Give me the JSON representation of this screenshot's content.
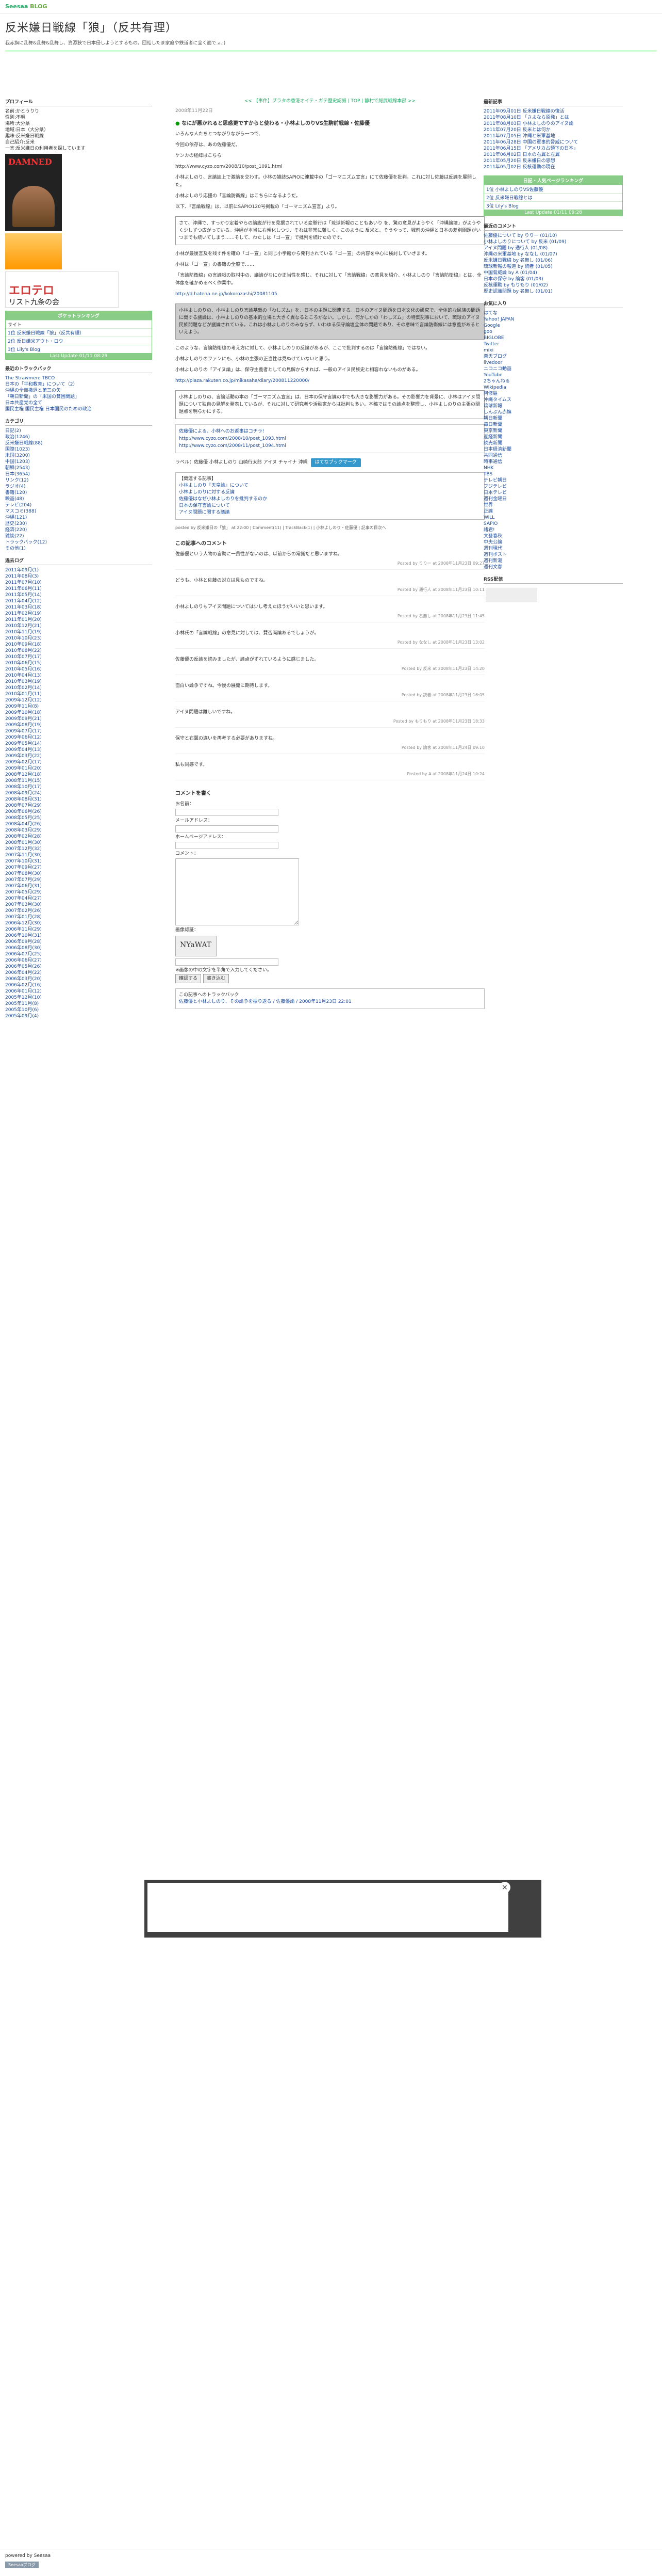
{
  "topbar": {
    "brand1": "Seesaa",
    "brand2": "BLOG"
  },
  "header": {
    "title": "反米嫌日戦線「狼」（反共有理）",
    "desc": "我赤旗に乱舞&乱舞&乱舞し、資源狭で日本侵しようとするもの。団結したま家庭や鉄道者に全く面で.a.:)"
  },
  "left": {
    "profile": {
      "h": "プロフィール",
      "rows": [
        "名前:かとうりり",
        "性別:不明",
        "場所:大分県",
        "地域:日本（大分県）",
        "趣味:反米嫌日戦線",
        "自己紹介:反米",
        "一言:反米嫌日の利用者を探しています"
      ]
    },
    "img1": "DAMNED",
    "img3_title": "エロテロ",
    "img3_sub": "リスト九条の会",
    "rank": {
      "hd": "ポケットランキング",
      "sub": "サイト",
      "rows": [
        "1位 反米嫌日戦線「狼」（反共有理）",
        "2位 反日嫌米アウト・ロウ",
        "3位 Lily's Blog"
      ],
      "ft": "Last Update 01/11 08:29"
    },
    "tb_h": "最近のトラックバック",
    "tb": [
      "The Strawmen: TBCO",
      "日本の「平和教育」について（2）",
      "沖縄の全面撤退と第三の矢",
      "「朝日新聞」の「米国の貧困問題」",
      "日本共産党の全て",
      "国民主権 国民主権 日本国民のための政治"
    ],
    "cat_h": "カテゴリ",
    "cats": [
      "日記(2)",
      "政治(1246)",
      "反米嫌日戦線(88)",
      "国際(1023)",
      "米国(3200)",
      "中国(1203)",
      "朝鮮(2543)",
      "日本(3654)",
      "リンク(12)",
      "ラジオ(4)",
      "書籍(120)",
      "映画(48)",
      "テレビ(204)",
      "マスコミ(388)",
      "沖縄(121)",
      "歴史(230)",
      "経済(220)",
      "雑談(22)",
      "トラックバック(12)",
      "その他(1)"
    ],
    "arch_h": "過去ログ",
    "archs": [
      "2011年09月(1)",
      "2011年08月(3)",
      "2011年07月(10)",
      "2011年06月(11)",
      "2011年05月(14)",
      "2011年04月(12)",
      "2011年03月(18)",
      "2011年02月(19)",
      "2011年01月(20)",
      "2010年12月(21)",
      "2010年11月(19)",
      "2010年10月(23)",
      "2010年09月(18)",
      "2010年08月(22)",
      "2010年07月(17)",
      "2010年06月(15)",
      "2010年05月(16)",
      "2010年04月(13)",
      "2010年03月(19)",
      "2010年02月(14)",
      "2010年01月(11)",
      "2009年12月(12)",
      "2009年11月(8)",
      "2009年10月(18)",
      "2009年09月(21)",
      "2009年08月(19)",
      "2009年07月(17)",
      "2009年06月(12)",
      "2009年05月(14)",
      "2009年04月(13)",
      "2009年03月(22)",
      "2009年02月(17)",
      "2009年01月(20)",
      "2008年12月(18)",
      "2008年11月(15)",
      "2008年10月(17)",
      "2008年09月(24)",
      "2008年08月(31)",
      "2008年07月(29)",
      "2008年06月(26)",
      "2008年05月(25)",
      "2008年04月(26)",
      "2008年03月(29)",
      "2008年02月(28)",
      "2008年01月(30)",
      "2007年12月(32)",
      "2007年11月(30)",
      "2007年10月(31)",
      "2007年09月(27)",
      "2007年08月(30)",
      "2007年07月(29)",
      "2007年06月(31)",
      "2007年05月(29)",
      "2007年04月(27)",
      "2007年03月(30)",
      "2007年02月(26)",
      "2007年01月(28)",
      "2006年12月(30)",
      "2006年11月(29)",
      "2006年10月(31)",
      "2006年09月(28)",
      "2006年08月(30)",
      "2006年07月(25)",
      "2006年06月(27)",
      "2006年05月(26)",
      "2006年04月(22)",
      "2006年03月(20)",
      "2006年02月(16)",
      "2006年01月(12)",
      "2005年12月(10)",
      "2005年11月(8)",
      "2005年10月(6)",
      "2005年09月(4)"
    ]
  },
  "main": {
    "nav": "<< 【事件】ブラタの香港オイテ・ガテ歴史認識 | TOP | 静村で総武戦線本部 >>",
    "date": "2008年11月22日",
    "title": "なにが悪かれると思惑更ですからと使わる・小林よしのりVS生駒前戦線・佐藤優",
    "paras": [
      "いろんな人たちとつながりながら一つで、",
      "今回の依存は、あの佐藤優だ。",
      "ケンカの経緯はこちら",
      "http://www.cyzo.com/2008/10/post_1091.html",
      "小林よしのり、言論誌上で激論を交わす。小林の雑誌SAPIOに連載中の「ゴーマニズム宣言」にて佐藤優を批判。これに対し佐藤は反論を展開した。",
      "小林よしのり応援の「言論防衛線」はこちらになるようだ。",
      "以下、『言論戦線』は、以前にSAPIO120号掲載の「ゴーマニズム宣言」より。"
    ],
    "quote": "さて、沖縄で、すっかり定着やらの論説が行を見据されている変懸行は「琉球新報のこともあいり を、驚の意見がようやく「沖縄論壇」がようやく少しずつ広がっている。沖縄が本当に右傾化しつつ、それは非常に難しく、このように 反米と。そうやって、戦前の沖縄と日本の差別問題がいつまでも続いてしまう……そして、わたしは「ゴー宣」で批判を続けたのです。",
    "paras2": [
      "小林が最後言及を残す件を確の「ゴー宣」と同じ小学館から発刊されている「ゴー宣」の内容を中心に検討していきます。",
      "小林は「ゴー宣」の書籍の全般で……",
      "「言論防衛線」の言論戦の取材中の、議論がなにか正当性を感じ、それに対して「言論戦線」の意見を紹介、小林よしのり『言論防衛線』とは、全体像を確かめるべく作業中。"
    ],
    "link2": "http://d.hatena.ne.jp/kokorozashi/20081105",
    "box": "小林よしのりの、小林よしのり言論基盤の「わしズム」を、日本の主題に関連する。日本のアイヌ問題を日本文化の研究で、全体的な民族の問題に関する議論は、小林よしのりの基本的立場と大きく異なるところがない。しかし、何かしかの「わしズム」の特集記事において、琉球のアイヌ民族問題などが議論されている。これは小林よしのりのみならず、いわゆる保守論壇全体の問題であり、その意味で言論防衛線には意義があるといえよう。",
    "paras3": [
      "このような、言論防衛線の考え方に対して、小林よしのりの反論があるが、ここで批判するのは「言論防衛線」ではない。",
      "小林よしのりのファンにも、小林の主張の正当性は見ぬけていないと思う。",
      "小林よしのりの「アイヌ論」は、保守主義者としての見解からすれば、一般のアイヌ民族史と相容れないものがある。"
    ],
    "link3": "http://plaza.rakuten.co.jp/mikasaha/diary/200811220000/",
    "box2": "小林よしのりの、言論活動の本の「ゴーマニズム宣言」は、日本の保守言論の中でも大きな影響力がある。その影響力を背景に、小林はアイヌ問題について独自の見解を発表しているが、それに対して研究者や活動家からは批判も多い。本稿ではその論点を整理し、小林よしのりの主張の問題点を明らかにする。",
    "links": [
      "佐藤優による、小林へのお返事はコチラ!",
      "http://www.cyzo.com/2008/10/post_1093.html",
      "http://www.cyzo.com/2008/11/post_1094.html"
    ],
    "label": "ラベル：佐藤優 小林よしのり 山崎行太郎 アイヌ チャイナ 沖縄",
    "bm": "はてなブックマーク",
    "related_h": "【関連する記事】",
    "related": [
      "小林よしのり『天皇論』について",
      "小林よしのりに対する反論",
      "佐藤優はなぜ小林よしのりを批判するのか",
      "日本の保守言論について",
      "アイヌ問題に関する議論"
    ],
    "posted": "posted by 反米嫌日の「狼」 at 22:00 | Comment(11) | TrackBack(1) | 小林よしのり・佐藤優 | 記事の目次へ",
    "comh": "この記事へのコメント",
    "comments": [
      {
        "t": "佐藤優という人物の言動に一貫性がないのは、以前からの常識だと思いますね。",
        "by": "Posted by りりー at 2008年11月23日 09:27"
      },
      {
        "t": "どうも、小林と佐藤の対立は見ものですね。",
        "by": "Posted by 通行人 at 2008年11月23日 10:11"
      },
      {
        "t": "小林よしのりもアイヌ問題については少し考えたほうがいいと思います。",
        "by": "Posted by 名無し at 2008年11月23日 11:45"
      },
      {
        "t": "小林氏の「言論戦線」の意見に対しては、賛否両論あるでしょうが。",
        "by": "Posted by ななし at 2008年11月23日 13:02"
      },
      {
        "t": "佐藤優の反論を読みましたが、論点がずれているように感じました。",
        "by": "Posted by 反米 at 2008年11月23日 14:20"
      },
      {
        "t": "面白い論争ですね。今後の展開に期待します。",
        "by": "Posted by 読者 at 2008年11月23日 16:05"
      },
      {
        "t": "アイヌ問題は難しいですね。",
        "by": "Posted by もりもり at 2008年11月23日 18:33"
      },
      {
        "t": "保守と右翼の違いを再考する必要がありますね。",
        "by": "Posted by 論客 at 2008年11月24日 09:10"
      },
      {
        "t": "私も同感です。",
        "by": "Posted by A at 2008年11月24日 10:24"
      }
    ],
    "form_h": "コメントを書く",
    "form": {
      "name": "お名前：",
      "mail": "メールアドレス：",
      "home": "ホームページアドレス：",
      "comment": "コメント：",
      "cap": "画像認証：",
      "capcode": "NYaWAT",
      "note": "※画像の中の文字を半角で入力してください。",
      "submit": "確認する",
      "post": "書き込む"
    },
    "tb_h": "この記事へのトラックバック",
    "tb": "佐藤優と小林よしのり、その論争を振り返る / 佐藤優論 / 2008年11月23日 22:01"
  },
  "right": {
    "new_h": "最新記事",
    "news": [
      "2011年09月01日 反米嫌日戦線の復活",
      "2011年08月10日 「さよなら原発」とは",
      "2011年08月03日 小林よしのりのアイヌ論",
      "2011年07月20日 反米とは何か",
      "2011年07月05日 沖縄と米軍基地",
      "2011年06月28日 中国の軍事的脅威について",
      "2011年06月15日 「アメリカ占領下の日本」",
      "2011年06月02日 日本の右翼と左翼",
      "2011年05月20日 反米嫌日の思想",
      "2011年05月02日 反核運動の現在"
    ],
    "rank_hd": "日記・人気ページランキング",
    "rank": [
      "1位 小林よしのりVS佐藤優",
      "2位 反米嫌日戦線とは",
      "3位 Lily's Blog"
    ],
    "rank_ft": "Last Update 01/11 09:28",
    "com_h": "最近のコメント",
    "coms": [
      "佐藤優について by りりー (01/10)",
      "小林よしのりについて by 反米 (01/09)",
      "アイヌ問題 by 通行人 (01/08)",
      "沖縄の米軍基地 by ななし (01/07)",
      "反米嫌日戦線 by 名無し (01/06)",
      "琉球新報の報道 by 読者 (01/05)",
      "中国脅威論 by A (01/04)",
      "日本の保守 by 論客 (01/03)",
      "反核運動 by もりもり (01/02)",
      "歴史認識問題 by 名無し (01/01)"
    ],
    "fav_h": "お気に入り",
    "favs": [
      "はてな",
      "Yahoo! JAPAN",
      "Google",
      "goo",
      "BIGLOBE",
      "Twitter",
      "mixi",
      "楽天ブログ",
      "livedoor",
      "ニコニコ動画",
      "YouTube",
      "2ちゃんねる",
      "Wikipedia",
      "阿修羅",
      "沖縄タイムス",
      "琉球新報",
      "しんぶん赤旗",
      "朝日新聞",
      "毎日新聞",
      "東京新聞",
      "産経新聞",
      "読売新聞",
      "日本経済新聞",
      "共同通信",
      "時事通信",
      "NHK",
      "TBS",
      "テレビ朝日",
      "フジテレビ",
      "日本テレビ",
      "週刊金曜日",
      "世界",
      "正論",
      "WiLL",
      "SAPIO",
      "諸君!",
      "文藝春秋",
      "中央公論",
      "週刊現代",
      "週刊ポスト",
      "週刊新潮",
      "週刊文春"
    ],
    "rss_h": "RSS配信"
  },
  "overlay": {
    "close": "×"
  },
  "footer": {
    "pw": "powered by Seesaa",
    "btn": "Seesaaブログ"
  }
}
